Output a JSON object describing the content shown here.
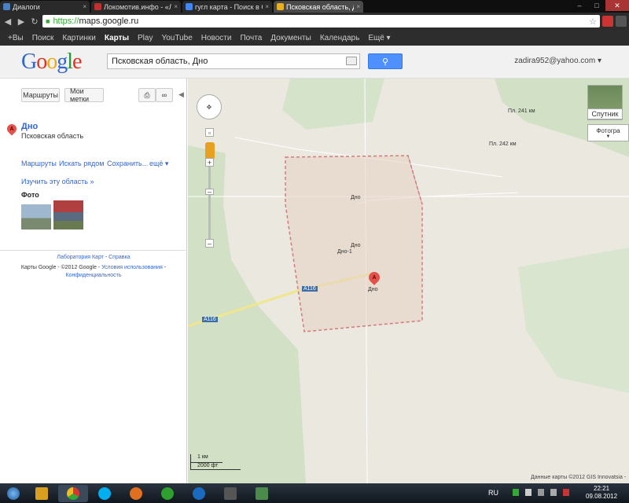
{
  "browser": {
    "tabs": [
      {
        "label": "Диалоги",
        "color": "#4a7fc1",
        "active": false
      },
      {
        "label": "Локомотив.инфо - «Локо",
        "color": "#c03030",
        "active": false
      },
      {
        "label": "гугл карта - Поиск в Goog",
        "color": "#4285f4",
        "active": false
      },
      {
        "label": "Псковская область, Дно",
        "color": "#e8b020",
        "active": true
      }
    ],
    "url": "https://maps.google.ru",
    "url_scheme": "https://",
    "url_host": "maps.google.ru"
  },
  "gbar": {
    "items": [
      "+Вы",
      "Поиск",
      "Картинки",
      "Карты",
      "Play",
      "YouTube",
      "Новости",
      "Почта",
      "Документы",
      "Календарь",
      "Ещё ▾"
    ],
    "active": "Карты"
  },
  "header": {
    "logo": "Google",
    "search_value": "Псковская область, Дно",
    "account": "zadira952@yahoo.com ▾"
  },
  "sidebar": {
    "routes_btn": "Маршруты",
    "mylabels_btn": "Мои метки",
    "place_marker": "A",
    "place_name": "Дно",
    "place_region": "Псковская область",
    "actions": [
      "Маршруты",
      "Искать рядом",
      "Сохранить...",
      "ещё ▾"
    ],
    "explore": "Изучить эту область »",
    "photos_heading": "Фото",
    "footer_lab": "Лаборатория Карт",
    "footer_sep": " - ",
    "footer_help": "Справка",
    "footer_copy": "Карты Google - ©2012 Google - ",
    "footer_terms": "Условия использования",
    "footer_dash": " - ",
    "footer_privacy": "Конфиденциальность"
  },
  "map": {
    "satellite_label": "Спутник",
    "photos_label": "Фотогра",
    "labels": [
      {
        "text": "Пл. 241 км"
      },
      {
        "text": "Пл. 242 км"
      },
      {
        "text": "Дно"
      },
      {
        "text": "Дно"
      },
      {
        "text": "Дно-1"
      },
      {
        "text": "Дно"
      }
    ],
    "road_label": "A116",
    "marker": "A",
    "scale_km": "1 км",
    "scale_ft": "2000 фт",
    "attribution": "Данные карты ©2012 GIS Innovatsia -"
  },
  "taskbar": {
    "lang": "RU",
    "time": "22:21",
    "date": "09.08.2012",
    "apps": [
      {
        "name": "explorer",
        "color": "#d9a020"
      },
      {
        "name": "chrome",
        "color": "#3c9a3c"
      },
      {
        "name": "skype",
        "color": "#00aff0"
      },
      {
        "name": "firefox",
        "color": "#e07020"
      },
      {
        "name": "utorrent",
        "color": "#2ea02e"
      },
      {
        "name": "teamviewer",
        "color": "#1a6bbf"
      },
      {
        "name": "media",
        "color": "#555555"
      },
      {
        "name": "network",
        "color": "#4a8a4a"
      }
    ]
  }
}
